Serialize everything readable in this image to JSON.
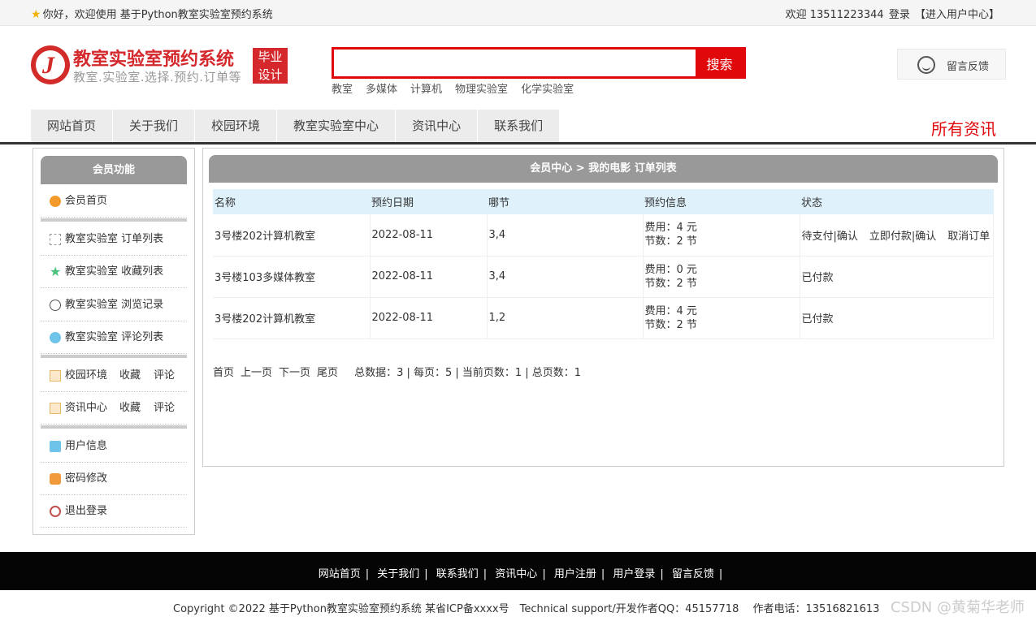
{
  "topbar": {
    "welcome": "你好，欢迎使用 基于Python教室实验室预约系统",
    "user_greeting": "欢迎 13511223344",
    "login": "登录",
    "user_center": "【进入用户中心】"
  },
  "header": {
    "brand_title": "教室实验室预约系统",
    "brand_sub": "教室.实验室.选择.预约.订单等",
    "badge_line1": "毕业",
    "badge_line2": "设计",
    "search_placeholder": "",
    "search_button": "搜索",
    "hot_keywords": [
      "教室",
      "多媒体",
      "计算机",
      "物理实验室",
      "化学实验室"
    ],
    "feedback": "留言反馈"
  },
  "nav": {
    "items": [
      "网站首页",
      "关于我们",
      "校园环境",
      "教室实验室中心",
      "资讯中心",
      "联系我们"
    ],
    "all_news": "所有资讯"
  },
  "sidebar": {
    "title": "会员功能",
    "home": "会员首页",
    "order_list": "教室实验室 订单列表",
    "fav_list": "教室实验室 收藏列表",
    "history": "教室实验室 浏览记录",
    "comment_list": "教室实验室 评论列表",
    "campus": "校园环境",
    "campus_fav": "收藏",
    "campus_comment": "评论",
    "news": "资讯中心",
    "news_fav": "收藏",
    "news_comment": "评论",
    "user_info": "用户信息",
    "password": "密码修改",
    "logout": "退出登录"
  },
  "main": {
    "title": "会员中心 > 我的电影 订单列表",
    "columns": [
      "名称",
      "预约日期",
      "哪节",
      "预约信息",
      "状态"
    ],
    "rows": [
      {
        "name": "3号楼202计算机教室",
        "date": "2022-08-11",
        "period": "3,4",
        "fee": "费用：4 元",
        "count": "节数：2 节",
        "status": [
          "待支付|确认",
          "立即付款|确认",
          "取消订单"
        ]
      },
      {
        "name": "3号楼103多媒体教室",
        "date": "2022-08-11",
        "period": "3,4",
        "fee": "费用：0 元",
        "count": "节数：2 节",
        "status": [
          "已付款"
        ]
      },
      {
        "name": "3号楼202计算机教室",
        "date": "2022-08-11",
        "period": "1,2",
        "fee": "费用：4 元",
        "count": "节数：2 节",
        "status": [
          "已付款"
        ]
      }
    ],
    "pager": {
      "first": "首页",
      "prev": "上一页",
      "next": "下一页",
      "last": "尾页",
      "info": "总数据：3 | 每页：5 | 当前页数：1 | 总页数：1"
    }
  },
  "footer": {
    "links": [
      "网站首页",
      "关于我们",
      "联系我们",
      "资讯中心",
      "用户注册",
      "用户登录",
      "留言反馈"
    ],
    "copyright": "Copyright ©2022 基于Python教室实验室预约系统 某省ICP备xxxx号　Technical support/开发作者QQ：45157718　 作者电话：13516821613",
    "watermark": "CSDN @黄菊华老师"
  }
}
